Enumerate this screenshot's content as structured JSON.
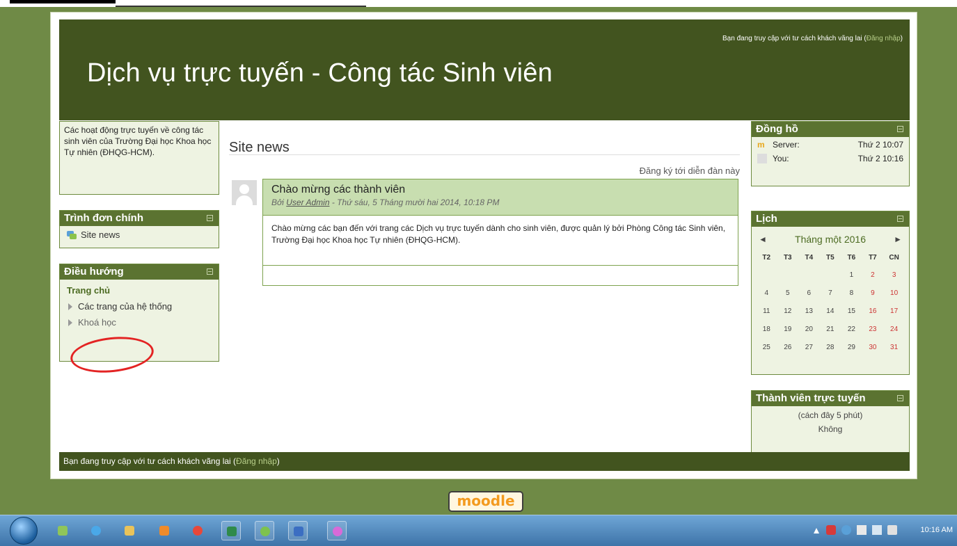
{
  "header": {
    "login_prefix": "Bạn đang truy cập với tư cách khách vãng lai (",
    "login_link": "Đăng nhập",
    "login_suffix": ")",
    "site_title": "Dịch vụ trực tuyến - Công tác Sinh viên"
  },
  "left": {
    "intro_text": "Các hoạt động trực tuyến về công tác sinh viên của Trường Đại học Khoa học Tự nhiên (ĐHQG-HCM).",
    "main_menu": {
      "title": "Trình đơn chính",
      "items": [
        "Site news"
      ]
    },
    "navigation": {
      "title": "Điều hướng",
      "home": "Trang chủ",
      "items": [
        "Các trang của hệ thống",
        "Khoá học"
      ]
    }
  },
  "center": {
    "section_title": "Site news",
    "subscribe_link": "Đăng ký tới diễn đàn này",
    "post": {
      "subject": "Chào mừng các thành viên",
      "by": "Bởi ",
      "author": "User Admin",
      "date": " - Thứ sáu, 5 Tháng mười hai 2014, 10:18 PM",
      "body": "Chào mừng các bạn đến với trang các Dịch vụ trực tuyến dành cho sinh viên, được quản lý bởi Phòng Công tác Sinh viên, Trường Đại học Khoa học Tự nhiên (ĐHQG-HCM)."
    }
  },
  "right": {
    "clock": {
      "title": "Đồng hồ",
      "rows": [
        {
          "label": "Server:",
          "value": "Thứ 2 10:07"
        },
        {
          "label": "You:",
          "value": "Thứ 2 10:16"
        }
      ]
    },
    "calendar": {
      "title": "Lịch",
      "prev": "◄",
      "month": "Tháng một 2016",
      "next": "►",
      "weekdays": [
        "T2",
        "T3",
        "T4",
        "T5",
        "T6",
        "T7",
        "CN"
      ],
      "weeks": [
        [
          "",
          "",
          "",
          "",
          "1",
          "2",
          "3"
        ],
        [
          "4",
          "5",
          "6",
          "7",
          "8",
          "9",
          "10"
        ],
        [
          "11",
          "12",
          "13",
          "14",
          "15",
          "16",
          "17"
        ],
        [
          "18",
          "19",
          "20",
          "21",
          "22",
          "23",
          "24"
        ],
        [
          "25",
          "26",
          "27",
          "28",
          "29",
          "30",
          "31"
        ]
      ]
    },
    "online_users": {
      "title": "Thành viên trực tuyến",
      "period": "(cách đây 5 phút)",
      "none": "Không"
    }
  },
  "footer": {
    "login_prefix": "Bạn đang truy cập với tư cách khách vãng lai (",
    "login_link": "Đăng nhập",
    "login_suffix": ")"
  },
  "moodle_logo": "moodle",
  "taskbar": {
    "clock": "10:16 AM",
    "icons": [
      "start-orb-icon",
      "gadget-icon",
      "internet-explorer-icon",
      "file-explorer-icon",
      "media-player-icon",
      "chrome-icon",
      "excel-icon",
      "app-icon",
      "word-icon",
      "paint-icon"
    ]
  },
  "colors": {
    "header_bg": "#42541f",
    "block_head": "#5b7331",
    "post_head": "#c8deb0",
    "page_bg": "#6f8a46",
    "annotation": "#e32323"
  }
}
